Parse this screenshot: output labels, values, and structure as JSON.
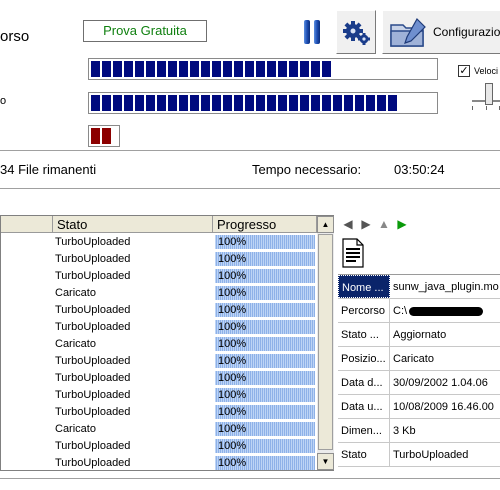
{
  "header": {
    "title_fragment": "orso",
    "side_label_fragment": "o",
    "trial_button": "Prova Gratuita",
    "config_button": "Configurazion",
    "speed_checkbox_label": "Veloci",
    "speed_checked": true
  },
  "progress": {
    "bar1_segments": 22,
    "bar2_segments": 28,
    "bar3_segments": 2
  },
  "status": {
    "files_remaining": "34 File rimanenti",
    "time_label": "Tempo necessario:",
    "time_value": "03:50:24"
  },
  "list": {
    "columns": [
      "",
      "Stato",
      "Progresso"
    ],
    "rows": [
      {
        "stato": "TurboUploaded",
        "progresso": "100%"
      },
      {
        "stato": "TurboUploaded",
        "progresso": "100%"
      },
      {
        "stato": "TurboUploaded",
        "progresso": "100%"
      },
      {
        "stato": "Caricato",
        "progresso": "100%"
      },
      {
        "stato": "TurboUploaded",
        "progresso": "100%"
      },
      {
        "stato": "TurboUploaded",
        "progresso": "100%"
      },
      {
        "stato": "Caricato",
        "progresso": "100%"
      },
      {
        "stato": "TurboUploaded",
        "progresso": "100%"
      },
      {
        "stato": "TurboUploaded",
        "progresso": "100%"
      },
      {
        "stato": "TurboUploaded",
        "progresso": "100%"
      },
      {
        "stato": "TurboUploaded",
        "progresso": "100%"
      },
      {
        "stato": "Caricato",
        "progresso": "100%"
      },
      {
        "stato": "TurboUploaded",
        "progresso": "100%"
      },
      {
        "stato": "TurboUploaded",
        "progresso": "100%"
      }
    ]
  },
  "properties": [
    {
      "key": "Nome ...",
      "value": "sunw_java_plugin.mo"
    },
    {
      "key": "Percorso",
      "value": "C:\\"
    },
    {
      "key": "Stato ...",
      "value": "Aggiornato"
    },
    {
      "key": "Posizio...",
      "value": "Caricato"
    },
    {
      "key": "Data d...",
      "value": "30/09/2002 1.04.06"
    },
    {
      "key": "Data u...",
      "value": "10/08/2009 16.46.00"
    },
    {
      "key": "Dimen...",
      "value": "3 Kb"
    },
    {
      "key": "Stato",
      "value": "TurboUploaded"
    }
  ],
  "icons": [
    "pause-icon",
    "gears-icon",
    "folder-config-icon",
    "arrow-left-icon",
    "arrow-right-icon",
    "arrow-up-icon",
    "play-icon",
    "document-icon"
  ],
  "colors": {
    "bar_blue": "#000a7e",
    "bar_red": "#8c0000",
    "trial_green": "#108010",
    "progress_fill": "#a9c4ee",
    "selection": "#0a246a"
  }
}
